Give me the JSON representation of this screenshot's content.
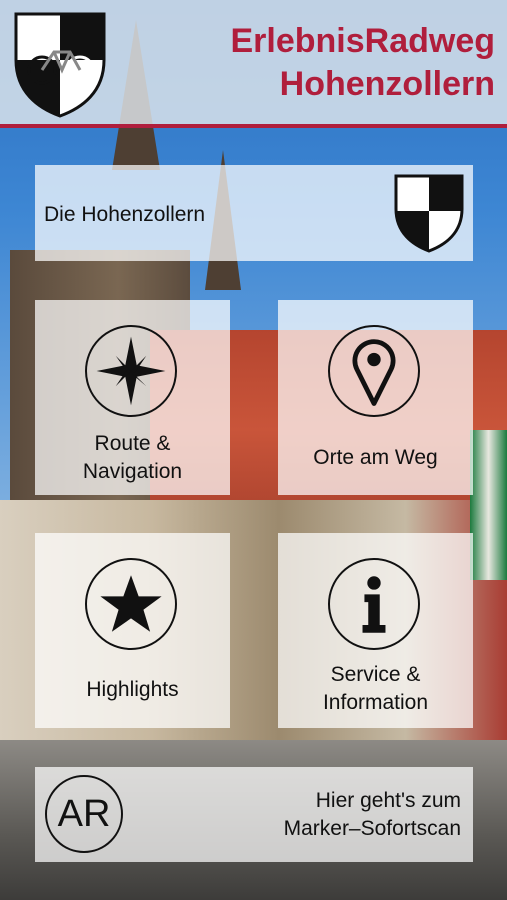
{
  "header": {
    "title_line1": "ErlebnisRadweg",
    "title_line2": "Hohenzollern",
    "logo_icon": "bicycle-crest-icon",
    "accent_color": "#b01e3c"
  },
  "tiles": {
    "hohenzollern": {
      "label": "Die Hohenzollern",
      "icon": "checkered-shield-icon"
    },
    "route": {
      "label_line1": "Route &",
      "label_line2": "Navigation",
      "icon": "compass-rose-icon"
    },
    "orte": {
      "label": "Orte am Weg",
      "icon": "map-pin-icon"
    },
    "highlights": {
      "label": "Highlights",
      "icon": "star-icon"
    },
    "service": {
      "label_line1": "Service &",
      "label_line2": "Information",
      "icon": "info-icon"
    },
    "ar": {
      "icon_text": "AR",
      "label_line1": "Hier geht's zum",
      "label_line2": "Marker–Sofortscan"
    }
  }
}
